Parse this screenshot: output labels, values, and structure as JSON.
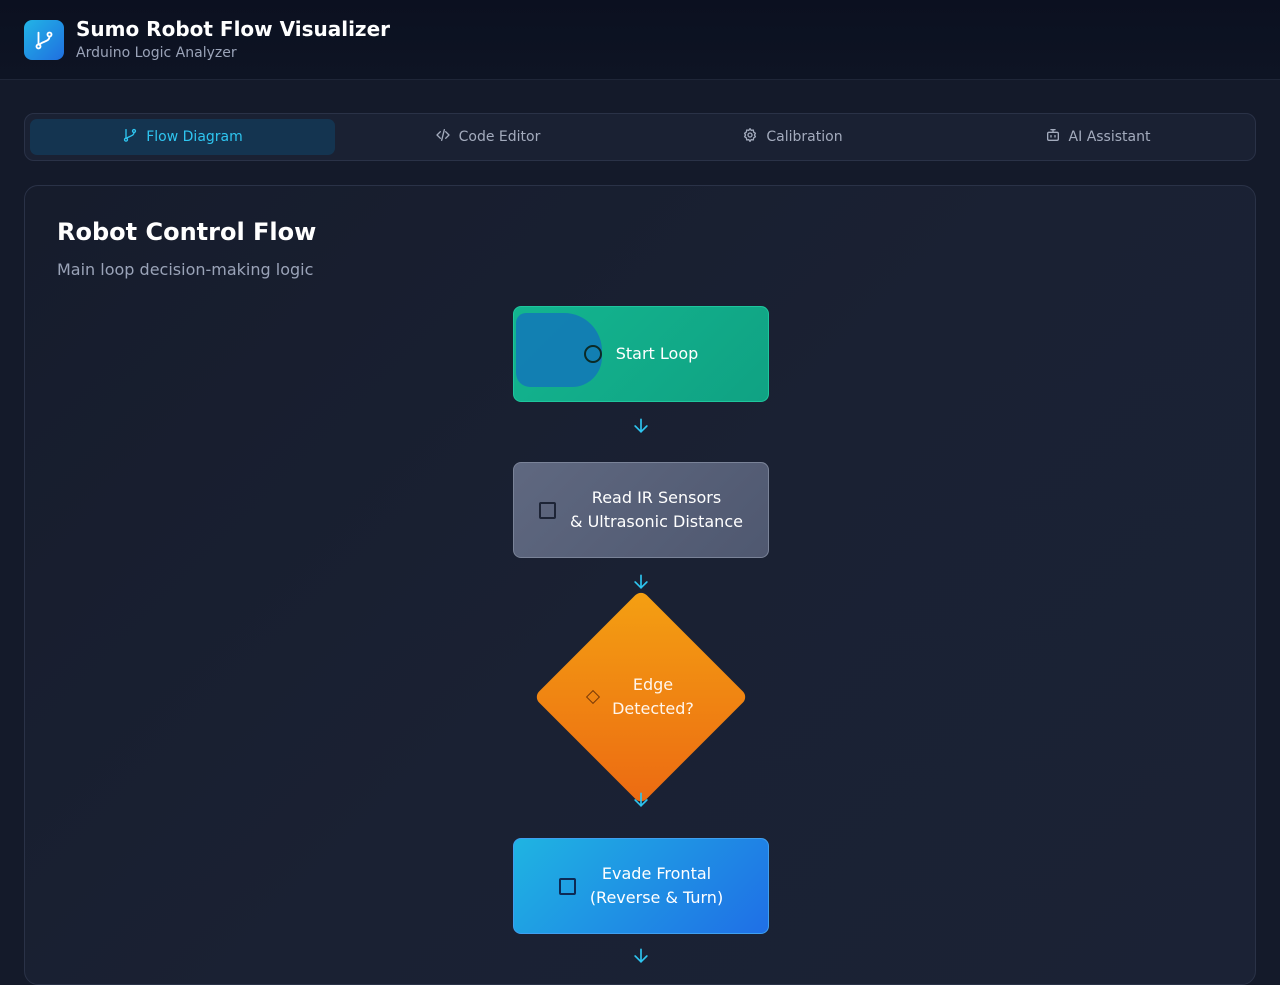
{
  "header": {
    "title": "Sumo Robot Flow Visualizer",
    "subtitle": "Arduino Logic Analyzer",
    "logo_icon": "git-branch-icon"
  },
  "tabs": [
    {
      "label": "Flow Diagram",
      "icon": "git-branch-icon",
      "active": true
    },
    {
      "label": "Code Editor",
      "icon": "code-icon",
      "active": false
    },
    {
      "label": "Calibration",
      "icon": "gear-icon",
      "active": false
    },
    {
      "label": "AI Assistant",
      "icon": "bot-icon",
      "active": false
    }
  ],
  "panel": {
    "title": "Robot Control Flow",
    "description": "Main loop decision-making logic"
  },
  "flow": {
    "start": {
      "label": "Start Loop",
      "icon": "circle-icon"
    },
    "read": {
      "line1": "Read IR Sensors",
      "line2": "& Ultrasonic Distance",
      "icon": "square-icon"
    },
    "decision": {
      "line1": "Edge",
      "line2": "Detected?",
      "icon": "diamond-icon"
    },
    "evade": {
      "line1": "Evade Frontal",
      "line2": "(Reverse & Turn)",
      "icon": "square-icon"
    }
  },
  "colors": {
    "accent": "#2ec5f0",
    "start": "#13b58f",
    "process": "#5f6880",
    "decision": "#f08a12",
    "action": "#1f8fe6"
  }
}
